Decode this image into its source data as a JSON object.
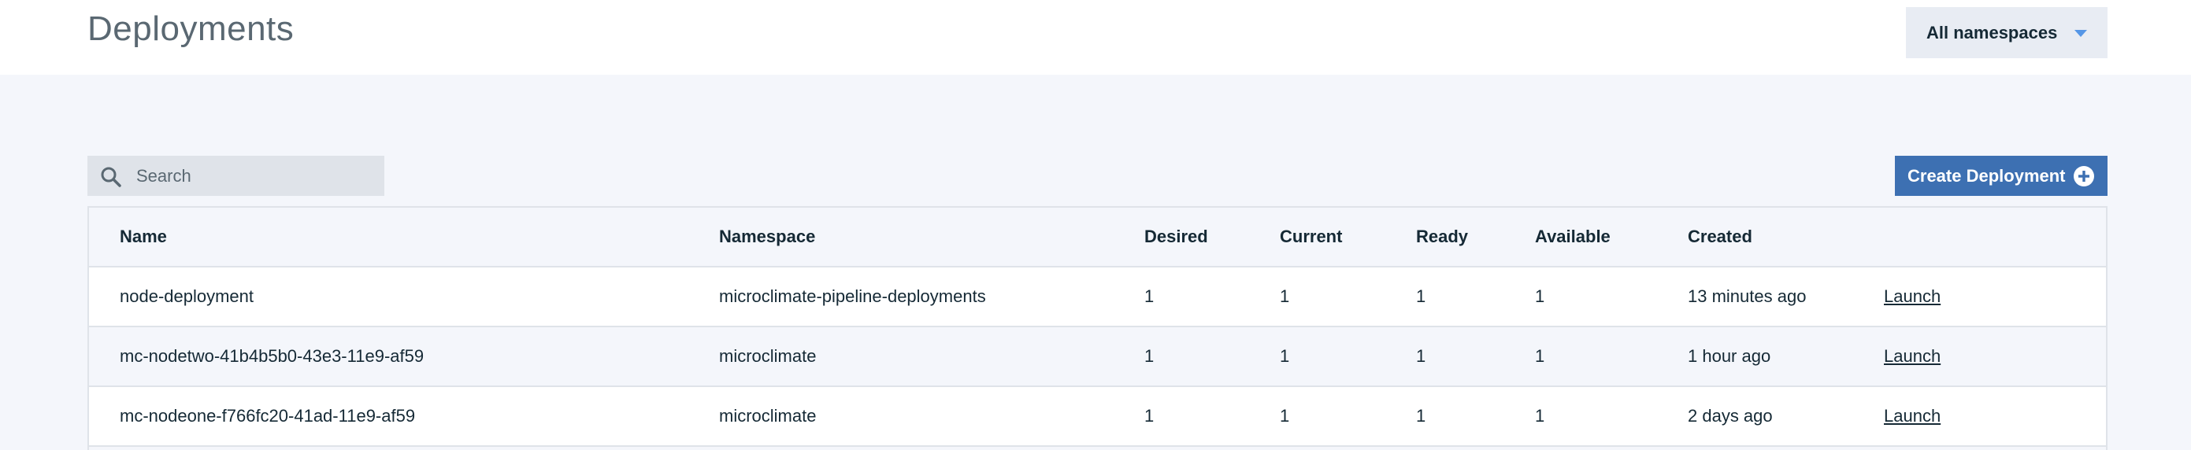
{
  "header": {
    "title": "Deployments",
    "namespace_selector": "All namespaces"
  },
  "toolbar": {
    "search_placeholder": "Search",
    "search_value": "",
    "create_label": "Create Deployment"
  },
  "table": {
    "columns": [
      "Name",
      "Namespace",
      "Desired",
      "Current",
      "Ready",
      "Available",
      "Created"
    ],
    "rows": [
      {
        "name": "node-deployment",
        "namespace": "microclimate-pipeline-deployments",
        "desired": "1",
        "current": "1",
        "ready": "1",
        "available": "1",
        "created": "13 minutes ago",
        "action": "Launch"
      },
      {
        "name": "mc-nodetwo-41b4b5b0-43e3-11e9-af59",
        "namespace": "microclimate",
        "desired": "1",
        "current": "1",
        "ready": "1",
        "available": "1",
        "created": "1 hour ago",
        "action": "Launch"
      },
      {
        "name": "mc-nodeone-f766fc20-41ad-11e9-af59",
        "namespace": "microclimate",
        "desired": "1",
        "current": "1",
        "ready": "1",
        "available": "1",
        "created": "2 days ago",
        "action": "Launch"
      }
    ]
  },
  "colors": {
    "primary_button": "#3d70b2",
    "page_background": "#f4f6fb",
    "caret": "#5596e6"
  },
  "icons": {
    "search": "search-icon",
    "create": "add-circle-icon",
    "dropdown": "caret-down-icon"
  }
}
